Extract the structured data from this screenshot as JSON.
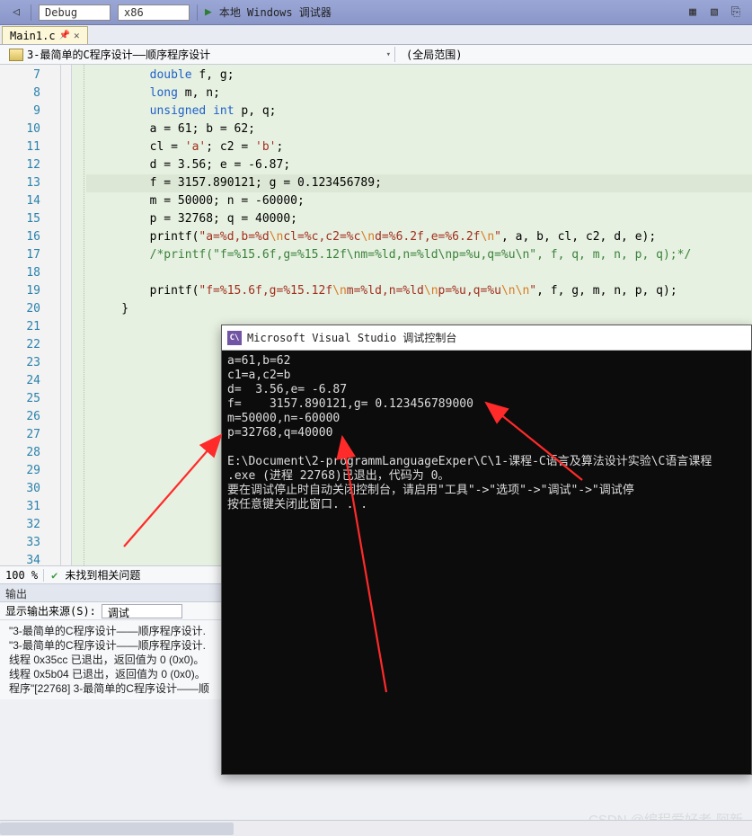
{
  "toolbar": {
    "config": "Debug",
    "platform": "x86",
    "run_label": "本地 Windows 调试器"
  },
  "tab": {
    "name": "Main1.c"
  },
  "navbar": {
    "scope_left": "3-最简单的C程序设计——顺序程序设计",
    "scope_right": "(全局范围)"
  },
  "code_lines": [
    {
      "n": 7,
      "tokens": [
        {
          "t": "        "
        },
        {
          "t": "double",
          "c": "kw"
        },
        {
          "t": " f, g;"
        }
      ]
    },
    {
      "n": 8,
      "tokens": [
        {
          "t": "        "
        },
        {
          "t": "long",
          "c": "kw"
        },
        {
          "t": " m, n;"
        }
      ]
    },
    {
      "n": 9,
      "tokens": [
        {
          "t": "        "
        },
        {
          "t": "unsigned int",
          "c": "kw"
        },
        {
          "t": " p, q;"
        }
      ]
    },
    {
      "n": 10,
      "tokens": [
        {
          "t": "        a = 61; b = 62;"
        }
      ]
    },
    {
      "n": 11,
      "tokens": [
        {
          "t": "        cl = "
        },
        {
          "t": "'a'",
          "c": "str"
        },
        {
          "t": "; c2 = "
        },
        {
          "t": "'b'",
          "c": "str"
        },
        {
          "t": ";"
        }
      ]
    },
    {
      "n": 12,
      "tokens": [
        {
          "t": "        d = 3.56; e = -6.87;"
        }
      ]
    },
    {
      "n": 13,
      "hl": true,
      "tokens": [
        {
          "t": "        f = 3157.890121; g = 0.123456789;"
        }
      ]
    },
    {
      "n": 14,
      "tokens": [
        {
          "t": "        m = 50000; n = -60000;"
        }
      ]
    },
    {
      "n": 15,
      "tokens": [
        {
          "t": "        p = 32768; q = 40000;"
        }
      ]
    },
    {
      "n": 16,
      "tokens": [
        {
          "t": "        printf("
        },
        {
          "t": "\"a=%d,b=%d",
          "c": "str"
        },
        {
          "t": "\\n",
          "c": "esc"
        },
        {
          "t": "cl=%c,c2=%c",
          "c": "str"
        },
        {
          "t": "\\n",
          "c": "esc"
        },
        {
          "t": "d=%6.2f,e=%6.2f",
          "c": "str"
        },
        {
          "t": "\\n",
          "c": "esc"
        },
        {
          "t": "\"",
          "c": "str"
        },
        {
          "t": ", a, b, cl, c2, d, e);"
        }
      ]
    },
    {
      "n": 17,
      "tokens": [
        {
          "t": "        "
        },
        {
          "t": "/*printf(\"f=%15.6f,g=%15.12f\\nm=%ld,n=%ld\\np=%u,q=%u\\n\", f, q, m, n, p, q);*/",
          "c": "cm"
        }
      ]
    },
    {
      "n": 18,
      "tokens": [
        {
          "t": ""
        }
      ]
    },
    {
      "n": 19,
      "tokens": [
        {
          "t": "        printf("
        },
        {
          "t": "\"f=%15.6f,g=%15.12f",
          "c": "str"
        },
        {
          "t": "\\n",
          "c": "esc"
        },
        {
          "t": "m=%ld,n=%ld",
          "c": "str"
        },
        {
          "t": "\\n",
          "c": "esc"
        },
        {
          "t": "p=%u,q=%u",
          "c": "str"
        },
        {
          "t": "\\n\\n",
          "c": "esc"
        },
        {
          "t": "\"",
          "c": "str"
        },
        {
          "t": ", f, g, m, n, p, q);"
        }
      ]
    },
    {
      "n": 20,
      "tokens": [
        {
          "t": "    }"
        }
      ]
    },
    {
      "n": 21,
      "tokens": [
        {
          "t": ""
        }
      ]
    },
    {
      "n": 22,
      "tokens": [
        {
          "t": ""
        }
      ]
    },
    {
      "n": 23,
      "tokens": [
        {
          "t": ""
        }
      ]
    },
    {
      "n": 24,
      "tokens": [
        {
          "t": ""
        }
      ]
    },
    {
      "n": 25,
      "tokens": [
        {
          "t": ""
        }
      ]
    },
    {
      "n": 26,
      "tokens": [
        {
          "t": ""
        }
      ]
    },
    {
      "n": 27,
      "tokens": [
        {
          "t": ""
        }
      ]
    },
    {
      "n": 28,
      "tokens": [
        {
          "t": ""
        }
      ]
    },
    {
      "n": 29,
      "tokens": [
        {
          "t": ""
        }
      ]
    },
    {
      "n": 30,
      "tokens": [
        {
          "t": ""
        }
      ]
    },
    {
      "n": 31,
      "tokens": [
        {
          "t": ""
        }
      ]
    },
    {
      "n": 32,
      "tokens": [
        {
          "t": ""
        }
      ]
    },
    {
      "n": 33,
      "tokens": [
        {
          "t": ""
        }
      ]
    },
    {
      "n": 34,
      "tokens": [
        {
          "t": ""
        }
      ]
    }
  ],
  "editor_footer": {
    "zoom": "100 %",
    "issues_label": "未找到相关问题"
  },
  "output": {
    "title": "输出",
    "source_label": "显示输出来源(S):",
    "source_value": "调试",
    "lines": [
      "\"3-最简单的C程序设计——顺序程序设计.",
      "\"3-最简单的C程序设计——顺序程序设计.",
      "线程 0x35cc 已退出，返回值为 0 (0x0)。",
      "线程 0x5b04 已退出，返回值为 0 (0x0)。",
      "程序\"[22768] 3-最简单的C程序设计——顺"
    ]
  },
  "console": {
    "title": "Microsoft Visual Studio 调试控制台",
    "lines": [
      "a=61,b=62",
      "c1=a,c2=b",
      "d=  3.56,e= -6.87",
      "f=    3157.890121,g= 0.123456789000",
      "m=50000,n=-60000",
      "p=32768,q=40000",
      "",
      "E:\\Document\\2-programmLanguageExper\\C\\1-课程-C语言及算法设计实验\\C语言课程",
      ".exe (进程 22768)已退出，代码为 0。",
      "要在调试停止时自动关闭控制台，请启用\"工具\"->\"选项\"->\"调试\"->\"调试停",
      "按任意键关闭此窗口. . ."
    ]
  },
  "watermark": "CSDN @编程爱好者-阿新"
}
